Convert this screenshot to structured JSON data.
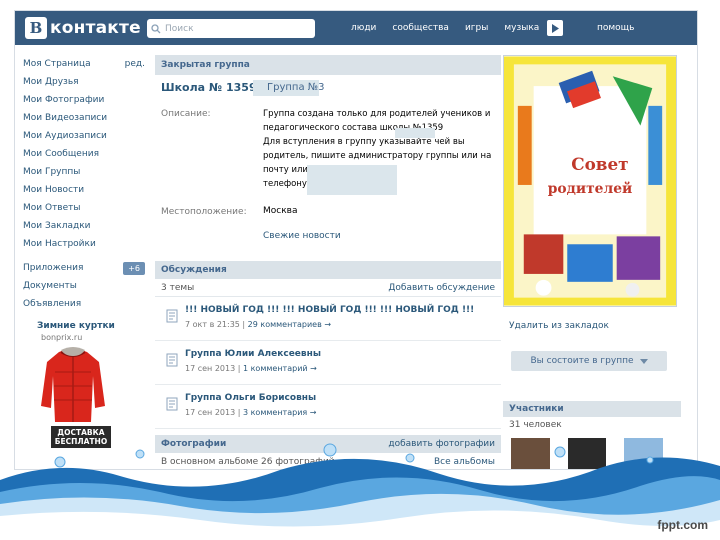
{
  "topbar": {
    "logo_letter": "B",
    "logo_text": "контакте",
    "search_placeholder": "Поиск",
    "nav": [
      "люди",
      "сообщества",
      "игры",
      "музыка"
    ],
    "help": "помощь"
  },
  "left_menu": {
    "items": [
      "Моя Страница",
      "Мои Друзья",
      "Мои Фотографии",
      "Мои Видеозаписи",
      "Мои Аудиозаписи",
      "Мои Сообщения",
      "Мои Группы",
      "Мои Новости",
      "Мои Ответы",
      "Мои Закладки",
      "Мои Настройки"
    ],
    "edit_label": "ред.",
    "items2": [
      "Приложения",
      "Документы",
      "Объявления"
    ],
    "apps_badge": "+6"
  },
  "ad": {
    "title": "Зимние куртки",
    "subtitle": "bonprix.ru",
    "delivery_line1": "ДОСТАВКА",
    "delivery_line2": "БЕСПЛАТНО"
  },
  "group": {
    "type_header": "Закрытая группа",
    "name": "Школа № 1359",
    "name_tail": "Группа №3",
    "description_label": "Описание:",
    "description_lines": [
      "Группа создана только для родителей учеников и",
      "педагогического состава            школы №1359",
      "Для вступления в группу указывайте чей вы",
      "родитель, пишите администратору группы или на",
      "почту                                или свяжитесь по",
      "телефону"
    ],
    "location_label": "Местоположение:",
    "location": "Москва",
    "news_link": "Свежие новости"
  },
  "discussions": {
    "header": "Обсуждения",
    "count": "3 темы",
    "add": "Добавить обсуждение",
    "topics": [
      {
        "title": "!!! НОВЫЙ ГОД !!! !!! НОВЫЙ ГОД !!! !!! НОВЫЙ ГОД !!!",
        "date": "7 окт в 21:35",
        "comments": "29 комментариев →"
      },
      {
        "title": "Группа Юлии Алексеевны",
        "date": "17 сен 2013",
        "comments": "1 комментарий →"
      },
      {
        "title": "Группа Ольги Борисовны",
        "date": "17 сен 2013",
        "comments": "3 комментария →"
      }
    ]
  },
  "photos": {
    "header": "Фотографии",
    "add": "добавить фотографии",
    "album_text": "В основном альбоме 26 фотографий",
    "all_albums": "Все альбомы"
  },
  "right": {
    "poster_text_line1": "Совет",
    "poster_text_line2": "родителей",
    "bookmark_link": "Удалить из закладок",
    "join_button": "Вы состоите в группе",
    "members_header": "Участники",
    "members_count": "31 человек"
  },
  "watermark": "fppt.com"
}
